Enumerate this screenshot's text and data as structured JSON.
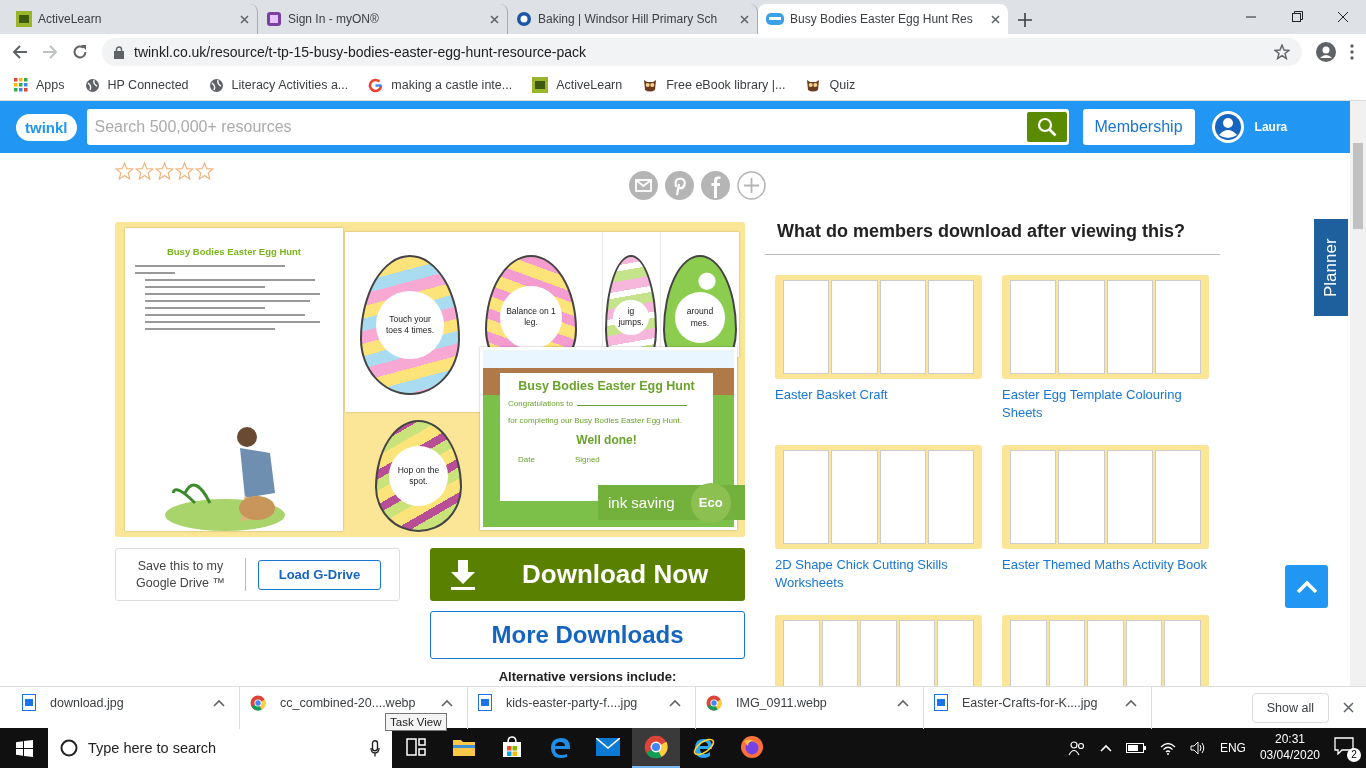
{
  "browser": {
    "tabs": [
      {
        "title": "ActiveLearn",
        "kind": "al",
        "selected": false
      },
      {
        "title": "Sign In - myON®",
        "kind": "myon",
        "selected": false
      },
      {
        "title": "Baking | Windsor Hill Primary Sch",
        "kind": "school",
        "selected": false
      },
      {
        "title": "Busy Bodies Easter Egg Hunt Res",
        "kind": "twinkl",
        "selected": true
      }
    ],
    "url": "twinkl.co.uk/resource/t-tp-15-busy-bodies-easter-egg-hunt-resource-pack",
    "bookmarks": [
      {
        "label": "Apps",
        "kind": "apps"
      },
      {
        "label": "HP Connected",
        "kind": "globe"
      },
      {
        "label": "Literacy Activities a...",
        "kind": "globe"
      },
      {
        "label": "making a castle inte...",
        "kind": "google"
      },
      {
        "label": "ActiveLearn",
        "kind": "al"
      },
      {
        "label": "Free eBook library |...",
        "kind": "owl"
      },
      {
        "label": "Quiz",
        "kind": "owl"
      }
    ]
  },
  "site_header": {
    "logo": "twinkl",
    "search_placeholder": "Search 500,000+ resources",
    "membership_button": "Membership",
    "user_name": "Laura"
  },
  "rating": {
    "stars": 0
  },
  "preview": {
    "worksheet_title": "Busy Bodies Easter Egg Hunt",
    "eggs": [
      {
        "text": "Touch your toes 4 times.",
        "kind": "pastel"
      },
      {
        "text": "Balance on 1 leg.",
        "kind": "zigzag"
      },
      {
        "text": "ig jumps.",
        "kind": "pink"
      },
      {
        "text": "around mes.",
        "kind": "green"
      },
      {
        "text": "Hop on the spot.",
        "kind": "bands"
      }
    ],
    "certificate": {
      "title": "Busy Bodies Easter Egg Hunt",
      "congratulations": "Congratulations to",
      "completing": "for completing our Busy Bodies Easter Egg Hunt.",
      "well_done": "Well done!",
      "date": "Date",
      "signed": "Signed"
    },
    "badge": {
      "label": "ink saving",
      "eco": "Eco"
    }
  },
  "google_drive": {
    "text": "Save this to my Google Drive ™",
    "button": "Load G-Drive"
  },
  "download_button": "Download Now",
  "more_downloads_button": "More Downloads",
  "alternative_versions": "Alternative versions include:",
  "related": {
    "title": "What do members download after viewing this?",
    "items": [
      {
        "title": "Easter Basket Craft",
        "kind": "full"
      },
      {
        "title": "Easter Egg Template Colouring Sheets",
        "kind": "full"
      },
      {
        "title": "2D Shape Chick Cutting Skills Worksheets",
        "kind": "full"
      },
      {
        "title": "Easter Themed Maths Activity Book",
        "kind": "full"
      },
      {
        "kind": "cut"
      },
      {
        "kind": "cut"
      }
    ]
  },
  "planner_tab": "Planner",
  "downloads": [
    {
      "name": "download.jpg",
      "kind": "image"
    },
    {
      "name": "cc_combined-20....webp",
      "kind": "chrome"
    },
    {
      "name": "kids-easter-party-f....jpg",
      "kind": "image"
    },
    {
      "name": "IMG_0911.webp",
      "kind": "chrome"
    },
    {
      "name": "Easter-Crafts-for-K....jpg",
      "kind": "image"
    }
  ],
  "show_all_button": "Show all",
  "tooltip": "Task View",
  "taskbar": {
    "search_placeholder": "Type here to search",
    "apps": [
      {
        "kind": "taskview",
        "active": false
      },
      {
        "kind": "explorer",
        "active": false
      },
      {
        "kind": "store",
        "active": false
      },
      {
        "kind": "edge",
        "active": false
      },
      {
        "kind": "mail",
        "active": false
      },
      {
        "kind": "chrome",
        "active": true
      },
      {
        "kind": "ie",
        "active": false
      },
      {
        "kind": "firefox",
        "active": false
      }
    ],
    "language": "ENG",
    "time": "20:31",
    "date": "03/04/2020",
    "notifications": "2"
  }
}
